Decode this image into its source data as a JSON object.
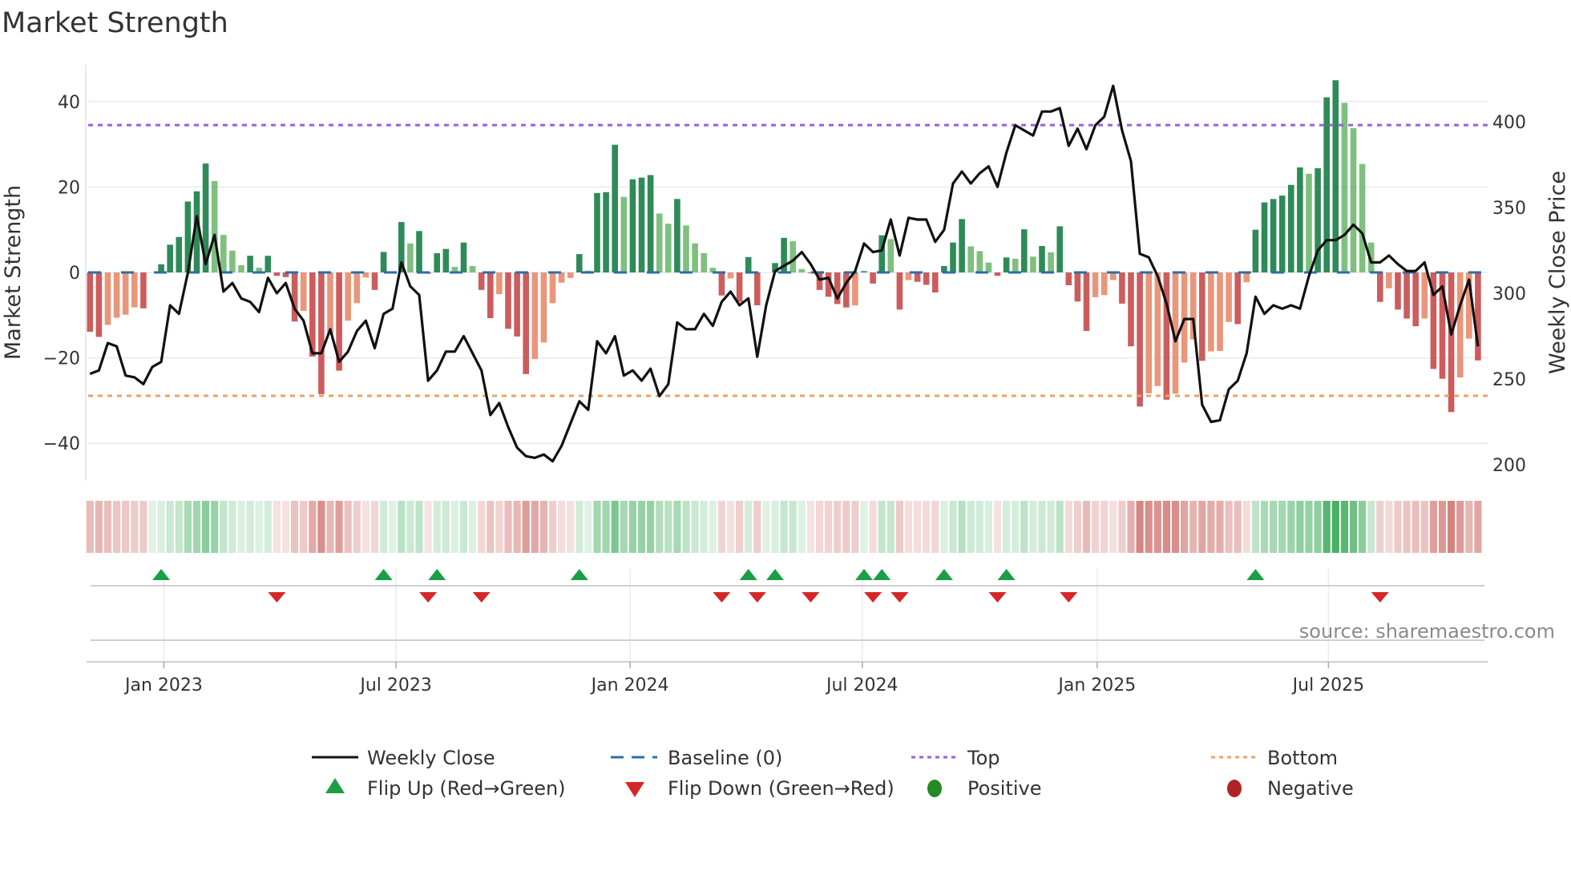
{
  "chart_data": {
    "type": "bar",
    "title": "Market Strength",
    "ylabel": "Market Strength",
    "y2label": "Weekly Close Price",
    "ylim": [
      -50,
      48
    ],
    "y2lim": [
      200,
      400
    ],
    "yticks": [
      {
        "v": 40,
        "label": "40"
      },
      {
        "v": 20,
        "label": "20"
      },
      {
        "v": 0,
        "label": "0"
      },
      {
        "v": -20,
        "label": "−20"
      },
      {
        "v": -40,
        "label": "−40"
      }
    ],
    "y2ticks": [
      {
        "v": 400,
        "label": "400"
      },
      {
        "v": 350,
        "label": "350"
      },
      {
        "v": 300,
        "label": "300"
      },
      {
        "v": 250,
        "label": "250"
      },
      {
        "v": 200,
        "label": "200"
      }
    ],
    "xticks": [
      {
        "week": 8.3,
        "label": "Jan 2023"
      },
      {
        "week": 34.4,
        "label": "Jul 2023"
      },
      {
        "week": 60.7,
        "label": "Jan 2024"
      },
      {
        "week": 86.8,
        "label": "Jul 2024"
      },
      {
        "week": 113.2,
        "label": "Jan 2025"
      },
      {
        "week": 139.2,
        "label": "Jul 2025"
      }
    ],
    "top_level": 34.5,
    "bottom_level": -28.9,
    "baseline": 0,
    "strength": [
      -13.9,
      -15.1,
      -12.3,
      -10.6,
      -9.9,
      -8.2,
      -8.4,
      0,
      1.9,
      6.5,
      8.3,
      16.6,
      19,
      25.5,
      21.4,
      8.8,
      5.1,
      1.7,
      3.9,
      1.1,
      3.9,
      -0.8,
      -1.1,
      -11.5,
      -9,
      -19.7,
      -28.5,
      -14.5,
      -23,
      -11.3,
      -7.2,
      -1.2,
      -4.1,
      4.8,
      0.3,
      11.8,
      6.8,
      9.7,
      -0.3,
      4.5,
      5.5,
      1.3,
      7,
      1.5,
      -4.1,
      -10.7,
      -5.1,
      -13.2,
      -15,
      -23.8,
      -20.3,
      -16.4,
      -7.2,
      -2.4,
      -1.3,
      4.3,
      0.4,
      18.6,
      18.8,
      29.9,
      17.7,
      21.8,
      22.2,
      22.8,
      13.8,
      11.4,
      17.2,
      11,
      6.8,
      4.5,
      1.1,
      -5.4,
      -1.4,
      -6.9,
      3.6,
      -7.7,
      0,
      2.2,
      8.1,
      7.3,
      0.8,
      -0.2,
      -4.1,
      -5.7,
      -7.4,
      -8.2,
      -7.7,
      0.3,
      -2.6,
      8.7,
      7.8,
      -8.7,
      -1.8,
      -2.2,
      -2.9,
      -4.7,
      1.5,
      7,
      12.5,
      6.1,
      5,
      2.3,
      -0.8,
      3.5,
      3.2,
      10.1,
      3.7,
      6.2,
      4.7,
      10.8,
      -3,
      -6.8,
      -13.7,
      -5.8,
      -5.3,
      -1.8,
      -7.3,
      -17.3,
      -31.4,
      -28.3,
      -26.6,
      -29.8,
      -28.4,
      -21.1,
      -15.7,
      -20.7,
      -18.5,
      -18.4,
      -11.6,
      -12.1,
      -2.3,
      10,
      16.4,
      17.2,
      18,
      20.5,
      24.6,
      23.1,
      24.4,
      41,
      45,
      39.7,
      33.8,
      25.4,
      7,
      -6.9,
      -3.7,
      -8.7,
      -10.8,
      -12.6,
      -10.8,
      -22.6,
      -24.9,
      -32.7,
      -24.6,
      -15.5,
      -20.6
    ],
    "weekly_close": [
      253,
      255,
      271,
      269,
      252,
      251,
      247,
      257,
      260,
      293,
      288,
      312,
      345,
      317,
      334,
      301,
      306,
      297,
      295,
      289,
      309,
      300,
      306,
      291,
      284,
      265,
      265,
      279,
      260,
      266,
      278,
      284,
      268,
      288,
      291,
      318,
      304,
      299,
      249,
      255,
      266,
      266,
      275,
      265,
      255,
      229,
      236,
      222,
      210,
      205,
      204,
      206,
      202,
      211,
      224,
      237,
      232,
      272,
      265,
      275,
      252,
      255,
      249,
      256,
      240,
      247,
      283,
      279,
      279,
      288,
      281,
      295,
      301,
      293,
      297,
      263,
      293,
      313,
      316,
      319,
      324,
      317,
      308,
      309,
      297,
      306,
      313,
      329,
      324,
      325,
      343,
      322,
      344,
      343,
      343,
      330,
      337,
      364,
      371,
      364,
      370,
      374,
      362,
      382,
      398,
      395,
      392,
      406,
      406,
      408,
      386,
      396,
      384,
      398,
      403,
      421,
      395,
      377,
      323,
      321,
      310,
      294,
      272,
      285,
      285,
      235,
      225,
      226,
      244,
      249,
      265,
      298,
      288,
      293,
      291,
      293,
      291,
      310,
      325,
      331,
      331,
      334,
      340,
      335,
      318,
      318,
      322,
      317,
      313,
      313,
      318,
      299,
      304,
      276,
      293,
      308,
      269
    ],
    "flip_up_weeks": [
      8,
      33,
      39,
      55,
      74,
      77,
      87,
      89,
      96,
      103,
      131
    ],
    "flip_down_weeks": [
      21,
      38,
      44,
      71,
      75,
      81,
      88,
      91,
      102,
      110,
      145
    ],
    "legend": {
      "weekly_close": "Weekly Close",
      "baseline": "Baseline (0)",
      "top": "Top",
      "bottom": "Bottom",
      "flip_up": "Flip Up (Red→Green)",
      "flip_down": "Flip Down (Green→Red)",
      "positive": "Positive",
      "negative": "Negative"
    },
    "legend_position": "bottom",
    "source": "source: sharemaestro.com",
    "colors": {
      "pos_strong": "#2e8b57",
      "pos_weak": "#7fbf7f",
      "neg_strong": "#cd5c5c",
      "neg_weak": "#e9967a",
      "line": "#111111",
      "baseline": "#2b6ea8",
      "top": "#9b5de5",
      "bottom": "#f0a060",
      "flip_up": "#1a9e46",
      "flip_down": "#d62728",
      "positive": "#228b22",
      "negative": "#b22222"
    }
  }
}
